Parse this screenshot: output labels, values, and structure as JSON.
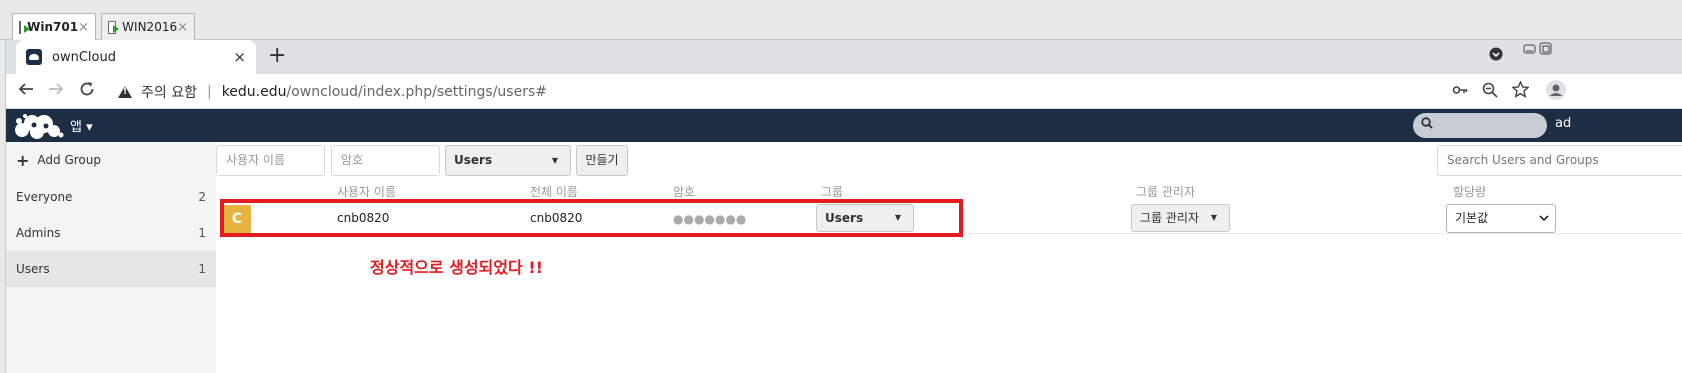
{
  "vm_tabs": [
    {
      "label": "Win701",
      "close": "×"
    },
    {
      "label": "WIN2016",
      "close": "×"
    }
  ],
  "browser": {
    "tab_title": "ownCloud",
    "tab_close": "×",
    "new_tab": "+",
    "security_label": "주의 요함",
    "separator": "|",
    "url_host": "kedu.edu",
    "url_path": "/owncloud/index.php/settings/users#"
  },
  "header": {
    "apps_label": "앱 ▾",
    "user_label": "ad"
  },
  "sidebar": {
    "add_group_label": "Add Group",
    "groups": [
      {
        "name": "Everyone",
        "count": "2"
      },
      {
        "name": "Admins",
        "count": "1"
      },
      {
        "name": "Users",
        "count": "1"
      }
    ]
  },
  "new_user_form": {
    "username_placeholder": "사용자 이름",
    "password_placeholder": "암호",
    "group_select": "Users",
    "create_button": "만들기",
    "search_placeholder": "Search Users and Groups"
  },
  "columns": {
    "username": "사용자 이름",
    "fullname": "전체 이름",
    "password": "암호",
    "groups": "그룹",
    "group_admin": "그룹 관리자",
    "quota": "할당량"
  },
  "users": [
    {
      "avatar_letter": "C",
      "username": "cnb0820",
      "fullname": "cnb0820",
      "password_mask": "●●●●●●●",
      "groups": "Users",
      "group_admin": "그룹 관리자",
      "quota": "기본값"
    }
  ],
  "annotation": "정상적으로 생성되었다 !!",
  "colors": {
    "header_bg": "#1d2d44",
    "annotation_red": "#e31b23",
    "avatar_bg": "#e8b440"
  }
}
